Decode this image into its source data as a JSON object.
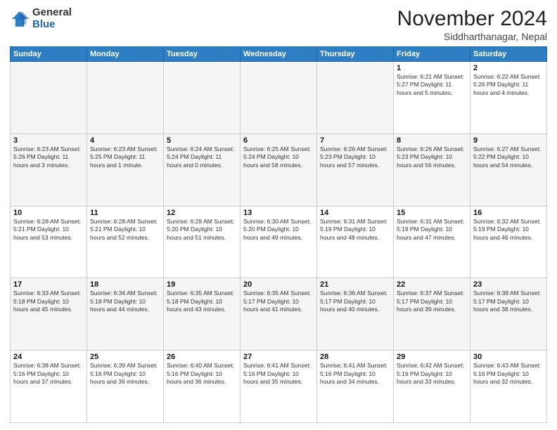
{
  "logo": {
    "general": "General",
    "blue": "Blue"
  },
  "header": {
    "month_title": "November 2024",
    "subtitle": "Siddharthanagar, Nepal"
  },
  "days_of_week": [
    "Sunday",
    "Monday",
    "Tuesday",
    "Wednesday",
    "Thursday",
    "Friday",
    "Saturday"
  ],
  "weeks": [
    [
      {
        "day": "",
        "info": "",
        "empty": true
      },
      {
        "day": "",
        "info": "",
        "empty": true
      },
      {
        "day": "",
        "info": "",
        "empty": true
      },
      {
        "day": "",
        "info": "",
        "empty": true
      },
      {
        "day": "",
        "info": "",
        "empty": true
      },
      {
        "day": "1",
        "info": "Sunrise: 6:21 AM\nSunset: 5:27 PM\nDaylight: 11 hours\nand 5 minutes."
      },
      {
        "day": "2",
        "info": "Sunrise: 6:22 AM\nSunset: 5:26 PM\nDaylight: 11 hours\nand 4 minutes."
      }
    ],
    [
      {
        "day": "3",
        "info": "Sunrise: 6:23 AM\nSunset: 5:26 PM\nDaylight: 11 hours\nand 3 minutes."
      },
      {
        "day": "4",
        "info": "Sunrise: 6:23 AM\nSunset: 5:25 PM\nDaylight: 11 hours\nand 1 minute."
      },
      {
        "day": "5",
        "info": "Sunrise: 6:24 AM\nSunset: 5:24 PM\nDaylight: 11 hours\nand 0 minutes."
      },
      {
        "day": "6",
        "info": "Sunrise: 6:25 AM\nSunset: 5:24 PM\nDaylight: 10 hours\nand 58 minutes."
      },
      {
        "day": "7",
        "info": "Sunrise: 6:26 AM\nSunset: 5:23 PM\nDaylight: 10 hours\nand 57 minutes."
      },
      {
        "day": "8",
        "info": "Sunrise: 6:26 AM\nSunset: 5:23 PM\nDaylight: 10 hours\nand 56 minutes."
      },
      {
        "day": "9",
        "info": "Sunrise: 6:27 AM\nSunset: 5:22 PM\nDaylight: 10 hours\nand 54 minutes."
      }
    ],
    [
      {
        "day": "10",
        "info": "Sunrise: 6:28 AM\nSunset: 5:21 PM\nDaylight: 10 hours\nand 53 minutes."
      },
      {
        "day": "11",
        "info": "Sunrise: 6:28 AM\nSunset: 5:21 PM\nDaylight: 10 hours\nand 52 minutes."
      },
      {
        "day": "12",
        "info": "Sunrise: 6:29 AM\nSunset: 5:20 PM\nDaylight: 10 hours\nand 51 minutes."
      },
      {
        "day": "13",
        "info": "Sunrise: 6:30 AM\nSunset: 5:20 PM\nDaylight: 10 hours\nand 49 minutes."
      },
      {
        "day": "14",
        "info": "Sunrise: 6:31 AM\nSunset: 5:19 PM\nDaylight: 10 hours\nand 48 minutes."
      },
      {
        "day": "15",
        "info": "Sunrise: 6:31 AM\nSunset: 5:19 PM\nDaylight: 10 hours\nand 47 minutes."
      },
      {
        "day": "16",
        "info": "Sunrise: 6:32 AM\nSunset: 5:19 PM\nDaylight: 10 hours\nand 46 minutes."
      }
    ],
    [
      {
        "day": "17",
        "info": "Sunrise: 6:33 AM\nSunset: 5:18 PM\nDaylight: 10 hours\nand 45 minutes."
      },
      {
        "day": "18",
        "info": "Sunrise: 6:34 AM\nSunset: 5:18 PM\nDaylight: 10 hours\nand 44 minutes."
      },
      {
        "day": "19",
        "info": "Sunrise: 6:35 AM\nSunset: 5:18 PM\nDaylight: 10 hours\nand 43 minutes."
      },
      {
        "day": "20",
        "info": "Sunrise: 6:35 AM\nSunset: 5:17 PM\nDaylight: 10 hours\nand 41 minutes."
      },
      {
        "day": "21",
        "info": "Sunrise: 6:36 AM\nSunset: 5:17 PM\nDaylight: 10 hours\nand 40 minutes."
      },
      {
        "day": "22",
        "info": "Sunrise: 6:37 AM\nSunset: 5:17 PM\nDaylight: 10 hours\nand 39 minutes."
      },
      {
        "day": "23",
        "info": "Sunrise: 6:38 AM\nSunset: 5:17 PM\nDaylight: 10 hours\nand 38 minutes."
      }
    ],
    [
      {
        "day": "24",
        "info": "Sunrise: 6:38 AM\nSunset: 5:16 PM\nDaylight: 10 hours\nand 37 minutes."
      },
      {
        "day": "25",
        "info": "Sunrise: 6:39 AM\nSunset: 5:16 PM\nDaylight: 10 hours\nand 36 minutes."
      },
      {
        "day": "26",
        "info": "Sunrise: 6:40 AM\nSunset: 5:16 PM\nDaylight: 10 hours\nand 36 minutes."
      },
      {
        "day": "27",
        "info": "Sunrise: 6:41 AM\nSunset: 5:16 PM\nDaylight: 10 hours\nand 35 minutes."
      },
      {
        "day": "28",
        "info": "Sunrise: 6:41 AM\nSunset: 5:16 PM\nDaylight: 10 hours\nand 34 minutes."
      },
      {
        "day": "29",
        "info": "Sunrise: 6:42 AM\nSunset: 5:16 PM\nDaylight: 10 hours\nand 33 minutes."
      },
      {
        "day": "30",
        "info": "Sunrise: 6:43 AM\nSunset: 5:16 PM\nDaylight: 10 hours\nand 32 minutes."
      }
    ]
  ]
}
